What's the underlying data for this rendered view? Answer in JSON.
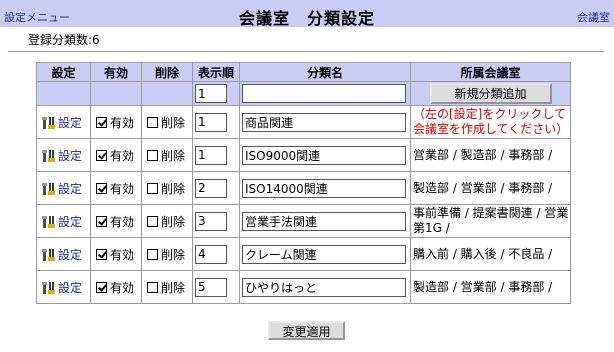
{
  "header": {
    "left_link": "設定メニュー",
    "title": "会議室　分類設定",
    "right_link": "会議室"
  },
  "summary": {
    "count_text": "登録分類数:6"
  },
  "table": {
    "headers": [
      "設定",
      "有効",
      "削除",
      "表示順",
      "分類名",
      "所属会議室"
    ],
    "add_row": {
      "order_value": "1",
      "name_value": "",
      "add_button": "新規分類追加"
    },
    "rows": [
      {
        "set_label": "設定",
        "enabled": true,
        "enabled_label": "有効",
        "delete": false,
        "delete_label": "削除",
        "order": "1",
        "name": "商品関連",
        "rooms": "（左の[設定]をクリックして会議室を作成してください）",
        "rooms_warn": true
      },
      {
        "set_label": "設定",
        "enabled": true,
        "enabled_label": "有効",
        "delete": false,
        "delete_label": "削除",
        "order": "1",
        "name": "ISO9000関連",
        "rooms": "営業部 / 製造部 / 事務部 /",
        "rooms_warn": false
      },
      {
        "set_label": "設定",
        "enabled": true,
        "enabled_label": "有効",
        "delete": false,
        "delete_label": "削除",
        "order": "2",
        "name": "ISO14000関連",
        "rooms": "製造部 / 営業部 / 事務部 /",
        "rooms_warn": false
      },
      {
        "set_label": "設定",
        "enabled": true,
        "enabled_label": "有効",
        "delete": false,
        "delete_label": "削除",
        "order": "3",
        "name": "営業手法関連",
        "rooms": "事前準備 / 提案書関連 / 営業第1G /",
        "rooms_warn": false
      },
      {
        "set_label": "設定",
        "enabled": true,
        "enabled_label": "有効",
        "delete": false,
        "delete_label": "削除",
        "order": "4",
        "name": "クレーム関連",
        "rooms": "購入前 / 購入後 / 不良品 /",
        "rooms_warn": false
      },
      {
        "set_label": "設定",
        "enabled": true,
        "enabled_label": "有効",
        "delete": false,
        "delete_label": "削除",
        "order": "5",
        "name": "ひやりはっと",
        "rooms": "製造部 / 営業部 / 事務部 /",
        "rooms_warn": false
      }
    ]
  },
  "footer": {
    "apply_button": "変更適用"
  },
  "colors": {
    "header_bg": "#c9cdf4",
    "link": "#1c2a9c",
    "warning": "#d40000"
  },
  "icons": {
    "settings": "tools-icon"
  }
}
